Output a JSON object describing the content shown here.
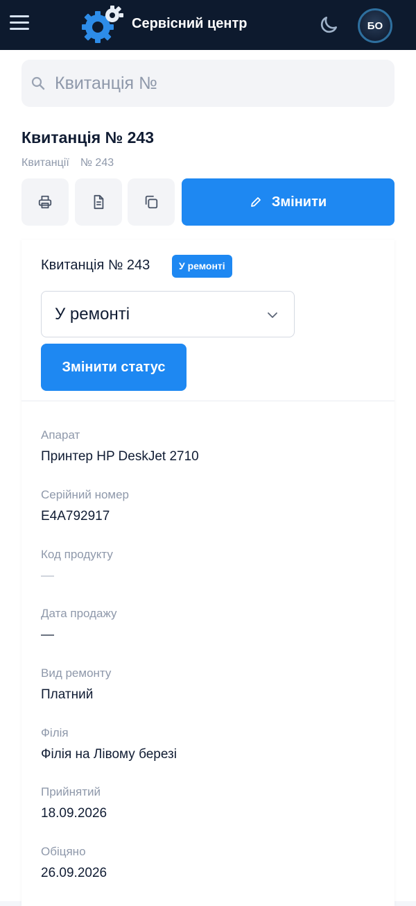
{
  "header": {
    "app_title": "Сервісний центр",
    "avatar_initials": "БО",
    "brand_color": "#0d1a2e",
    "accent_color": "#1e88f2",
    "icons": [
      "menu-icon",
      "gear-logo-icon",
      "moon-icon"
    ]
  },
  "search": {
    "placeholder": "Квитанція №"
  },
  "page": {
    "title": "Квитанція № 243",
    "breadcrumbs": [
      "Квитанції",
      "№ 243"
    ]
  },
  "toolbar": {
    "icons": [
      "print-icon",
      "document-icon",
      "copy-icon"
    ],
    "edit_label": "Змінити"
  },
  "card": {
    "title": "Квитанція № 243",
    "status_badge": "У ремонті",
    "status_select_value": "У ремонті",
    "change_status_label": "Змінити статус",
    "fields": [
      {
        "label": "Апарат",
        "value": "Принтер HP DeskJet 2710"
      },
      {
        "label": "Серійний номер",
        "value": "E4A792917"
      },
      {
        "label": "Код продукту",
        "value": "—"
      },
      {
        "label": "Дата продажу",
        "value": "—"
      },
      {
        "label": "Вид ремонту",
        "value": "Платний"
      },
      {
        "label": "Філія",
        "value": "Філія на Лівому березі"
      },
      {
        "label": "Прийнятий",
        "value": "18.09.2026"
      },
      {
        "label": "Обіцяно",
        "value": "26.09.2026"
      }
    ]
  }
}
